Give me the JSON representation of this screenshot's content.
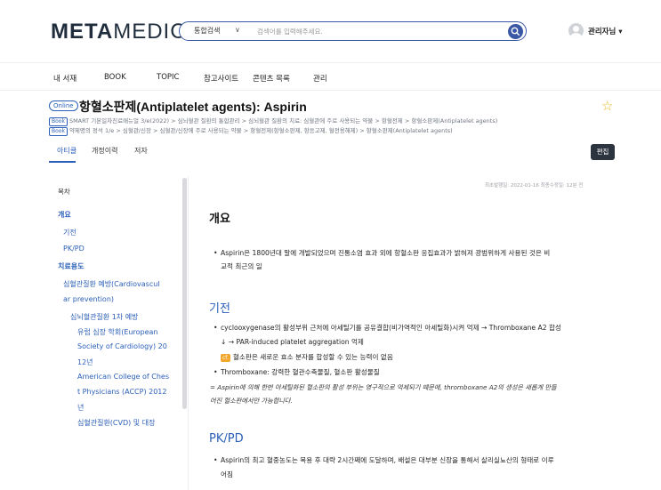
{
  "header": {
    "logo_bold": "META",
    "logo_light": "MEDIC",
    "search_scope": "통합검색",
    "search_caret": "∨",
    "search_placeholder": "검색어를 입력해주세요.",
    "user_name": "관리자님 ▾"
  },
  "nav": [
    "내 서재",
    "BOOK",
    "TOPIC",
    "참고사이트",
    "콘텐츠 목록",
    "관리"
  ],
  "article": {
    "badge": "Online",
    "title": "항혈소판제(Antiplatelet agents): Aspirin",
    "crumbs": [
      {
        "tag": "Book",
        "text": "SMART 기본일차진료매뉴얼 3/e(2022) > 심뇌혈관 질환의 통합관리 > 심뇌혈관 질환의 치료: 심혈관에 주로 사용되는 약물 > 항혈전제 > 항혈소판제(Antiplatelet agents)"
      },
      {
        "tag": "Book",
        "text": "약제명의 정석 1/e > 심혈관/신장 > 심혈관/신장에 주로 사용되는 약물 > 항혈전제(항혈소판제, 항응고제, 혈전용해제) > 항혈소판제(Antiplatelet agents)"
      }
    ],
    "tabs": [
      "아티클",
      "개정이력",
      "저자"
    ],
    "edit_label": "편집",
    "dates": "최초발행일: 2022-01-16   최종수정일: 12분 전"
  },
  "toc": {
    "title": "목차",
    "items": [
      "개요",
      "기전",
      "PK/PD",
      "치료용도",
      "심혈관질환 예방(Cardiovascul",
      "ar prevention)",
      "심뇌혈관질환 1차 예방",
      "유럽 심장 학회(European",
      "Society of Cardiology) 20",
      "12년",
      "American College of Ches",
      "t Physicians (ACCP) 2012",
      "년",
      "심혈관질환(CVD) 및 대장"
    ]
  },
  "content": {
    "overview_heading": "개요",
    "overview_line1": "Aspirin은 1800년대 말에 개발되었으며 진통소염 효과 외에 항혈소판 응집효과가 밝혀져 광범위하게 사용된 것은 비",
    "overview_line2": "교적 최근의 일",
    "mech_heading": "기전",
    "mech_line1": "cyclooxygenase의 활성부위 근처에 아세틸기를 공유결합(비가역적인 아세틸화)시켜 억제 → Thromboxane A2 합성",
    "mech_line2": "↓ → PAR-induced platelet aggregation 억제",
    "mech_note_badge": "cf.",
    "mech_note": "혈소판은 새로운 효소 분자를 합성할 수 있는 능력이 없음",
    "mech_line3": "Thromboxane: 강력한 혈관수축물질, 혈소판 활성물질",
    "mech_italic1": "= Aspirin에 의해 한번 아세틸화된 혈소판의 활성 부위는 영구적으로 억제되기 때문에, thromboxane A2의 생성은 새롭게 만들",
    "mech_italic2": "어진 혈소판에서만 가능합니다.",
    "pk_heading": "PK/PD",
    "pk_line1": "Aspirin의 최고 혈중농도는 복용 후 대략 2시간째에 도달하며, 배설은 대부분 신장을 통해서 살리실뇨산의 형태로 이루",
    "pk_line2": "어짐",
    "bullet": "•"
  },
  "colors": {
    "accent": "#2b5fb8",
    "star": "#e8b620",
    "badge": "#f2a62b"
  }
}
